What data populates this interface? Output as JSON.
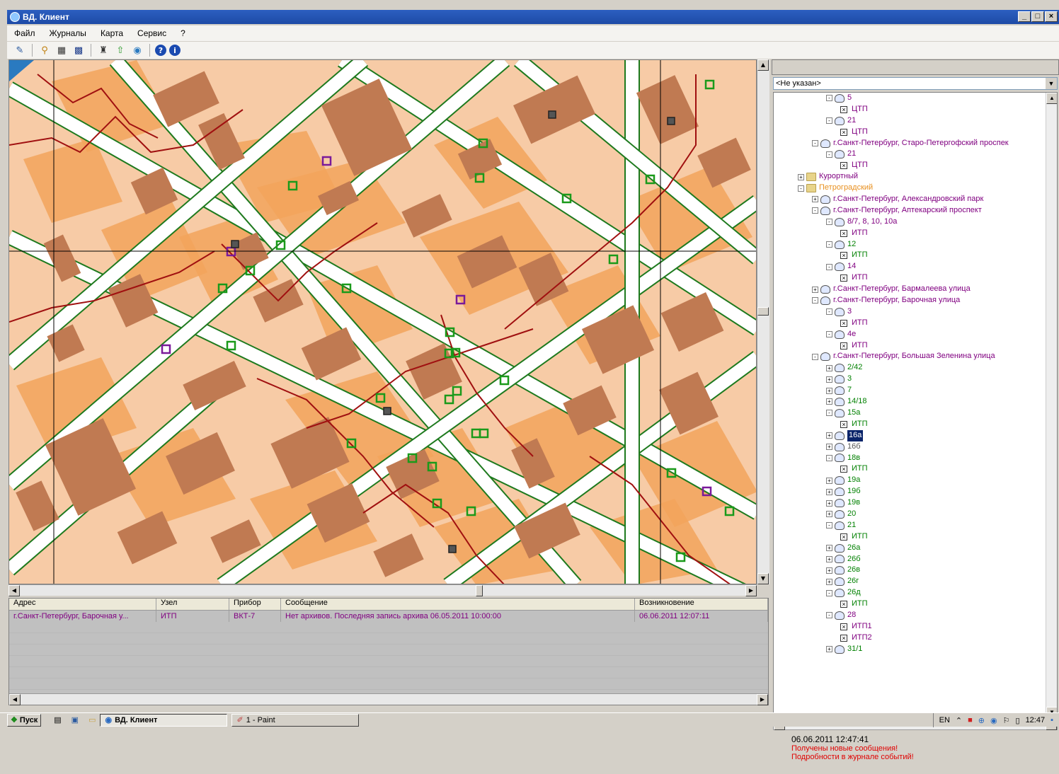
{
  "window": {
    "title": "ВД. Клиент",
    "min": "_",
    "max": "□",
    "close": "×"
  },
  "menu": [
    "Файл",
    "Журналы",
    "Карта",
    "Сервис",
    "?"
  ],
  "toolbar_icons": [
    "edit-icon",
    "zoom-icon",
    "layers-icon",
    "map-icon",
    "search-icon",
    "up-arrow-icon",
    "globe-icon",
    "help-icon",
    "info-icon"
  ],
  "events": {
    "columns": [
      "Адрес",
      "Узел",
      "Прибор",
      "Сообщение",
      "Возникновение"
    ],
    "rows": [
      {
        "address": "г.Санкт-Петербург, Барочная у...",
        "node": "ИТП",
        "device": "ВКТ-7",
        "message": "Нет архивов. Последняя запись архива 06.05.2011 10:00:00",
        "time": "06.06.2011 12:07:11"
      }
    ]
  },
  "panel": {
    "combo": "<Не указан>",
    "tree": [
      {
        "level": 3,
        "exp": "-",
        "icon": "node",
        "text": "5",
        "cls": "t-purple"
      },
      {
        "level": 4,
        "icon": "chk",
        "text": "ЦТП",
        "cls": "t-purple"
      },
      {
        "level": 3,
        "exp": "-",
        "icon": "node",
        "text": "21",
        "cls": "t-purple"
      },
      {
        "level": 4,
        "icon": "chk",
        "text": "ЦТП",
        "cls": "t-purple"
      },
      {
        "level": 2,
        "exp": "-",
        "icon": "node",
        "text": "г.Санкт-Петербург, Старо-Петергофский проспек",
        "cls": "t-purple"
      },
      {
        "level": 3,
        "exp": "-",
        "icon": "node",
        "text": "21",
        "cls": "t-purple"
      },
      {
        "level": 4,
        "icon": "chk",
        "text": "ЦТП",
        "cls": "t-purple"
      },
      {
        "level": 1,
        "exp": "+",
        "icon": "folder",
        "text": "Курортный",
        "cls": "t-purple"
      },
      {
        "level": 1,
        "exp": "-",
        "icon": "folder",
        "text": "Петроградский",
        "cls": "t-orange"
      },
      {
        "level": 2,
        "exp": "+",
        "icon": "node",
        "text": "г.Санкт-Петербург, Александровский парк",
        "cls": "t-purple"
      },
      {
        "level": 2,
        "exp": "-",
        "icon": "node",
        "text": "г.Санкт-Петербург, Аптекарский проспект",
        "cls": "t-purple"
      },
      {
        "level": 3,
        "exp": "-",
        "icon": "node",
        "text": "8/7, 8, 10, 10а",
        "cls": "t-purple"
      },
      {
        "level": 4,
        "icon": "chk",
        "text": "ИТП",
        "cls": "t-purple"
      },
      {
        "level": 3,
        "exp": "-",
        "icon": "node",
        "text": "12",
        "cls": "t-green"
      },
      {
        "level": 4,
        "icon": "chk",
        "text": "ИТП",
        "cls": "t-green"
      },
      {
        "level": 3,
        "exp": "-",
        "icon": "node",
        "text": "14",
        "cls": "t-purple"
      },
      {
        "level": 4,
        "icon": "chk",
        "text": "ИТП",
        "cls": "t-purple"
      },
      {
        "level": 2,
        "exp": "+",
        "icon": "node",
        "text": "г.Санкт-Петербург, Бармалеева улица",
        "cls": "t-purple"
      },
      {
        "level": 2,
        "exp": "-",
        "icon": "node",
        "text": "г.Санкт-Петербург, Барочная улица",
        "cls": "t-purple"
      },
      {
        "level": 3,
        "exp": "-",
        "icon": "node",
        "text": "3",
        "cls": "t-purple"
      },
      {
        "level": 4,
        "icon": "chk",
        "text": "ИТП",
        "cls": "t-purple"
      },
      {
        "level": 3,
        "exp": "-",
        "icon": "node",
        "text": "4е",
        "cls": "t-purple"
      },
      {
        "level": 4,
        "icon": "chk",
        "text": "ИТП",
        "cls": "t-purple"
      },
      {
        "level": 2,
        "exp": "-",
        "icon": "node",
        "text": "г.Санкт-Петербург, Большая Зеленина улица",
        "cls": "t-purple"
      },
      {
        "level": 3,
        "exp": "+",
        "icon": "node",
        "text": "2/42",
        "cls": "t-green"
      },
      {
        "level": 3,
        "exp": "+",
        "icon": "node",
        "text": "3",
        "cls": "t-green"
      },
      {
        "level": 3,
        "exp": "+",
        "icon": "node",
        "text": "7",
        "cls": "t-green"
      },
      {
        "level": 3,
        "exp": "+",
        "icon": "node",
        "text": "14/18",
        "cls": "t-green"
      },
      {
        "level": 3,
        "exp": "-",
        "icon": "node",
        "text": "15а",
        "cls": "t-green"
      },
      {
        "level": 4,
        "icon": "chk",
        "text": "ИТП",
        "cls": "t-green"
      },
      {
        "level": 3,
        "exp": "+",
        "icon": "node",
        "text": "16а",
        "cls": "t-sel"
      },
      {
        "level": 3,
        "exp": "+",
        "icon": "node",
        "text": "16б",
        "cls": "t-gray"
      },
      {
        "level": 3,
        "exp": "-",
        "icon": "node",
        "text": "18в",
        "cls": "t-green"
      },
      {
        "level": 4,
        "icon": "chk",
        "text": "ИТП",
        "cls": "t-green"
      },
      {
        "level": 3,
        "exp": "+",
        "icon": "node",
        "text": "19а",
        "cls": "t-green"
      },
      {
        "level": 3,
        "exp": "+",
        "icon": "node",
        "text": "19б",
        "cls": "t-green"
      },
      {
        "level": 3,
        "exp": "+",
        "icon": "node",
        "text": "19в",
        "cls": "t-green"
      },
      {
        "level": 3,
        "exp": "+",
        "icon": "node",
        "text": "20",
        "cls": "t-green"
      },
      {
        "level": 3,
        "exp": "-",
        "icon": "node",
        "text": "21",
        "cls": "t-green"
      },
      {
        "level": 4,
        "icon": "chk",
        "text": "ИТП",
        "cls": "t-green"
      },
      {
        "level": 3,
        "exp": "+",
        "icon": "node",
        "text": "26а",
        "cls": "t-green"
      },
      {
        "level": 3,
        "exp": "+",
        "icon": "node",
        "text": "26б",
        "cls": "t-green"
      },
      {
        "level": 3,
        "exp": "+",
        "icon": "node",
        "text": "26в",
        "cls": "t-green"
      },
      {
        "level": 3,
        "exp": "+",
        "icon": "node",
        "text": "26г",
        "cls": "t-green"
      },
      {
        "level": 3,
        "exp": "-",
        "icon": "node",
        "text": "26д",
        "cls": "t-green"
      },
      {
        "level": 4,
        "icon": "chk",
        "text": "ИТП",
        "cls": "t-green"
      },
      {
        "level": 3,
        "exp": "-",
        "icon": "node",
        "text": "28",
        "cls": "t-purple"
      },
      {
        "level": 4,
        "icon": "chk",
        "text": "ИТП1",
        "cls": "t-purple"
      },
      {
        "level": 4,
        "icon": "chk",
        "text": "ИТП2",
        "cls": "t-purple"
      },
      {
        "level": 3,
        "exp": "+",
        "icon": "node",
        "text": "31/1",
        "cls": "t-green"
      }
    ],
    "status_time": "06.06.2011 12:47:41",
    "status_line1": "Получены новые сообщения!",
    "status_line2": "Подробности в журнале событий!"
  },
  "taskbar": {
    "start": "Пуск",
    "task1": "ВД. Клиент",
    "task2": "1 - Paint",
    "lang": "EN",
    "clock": "12:47"
  },
  "colors": {
    "map_bg": "#f7cba6",
    "building": "#c07a52",
    "block": "#f2a45c",
    "street": "#ffffff",
    "street_edge": "#1e7a1e",
    "pipe": "#a01010"
  }
}
